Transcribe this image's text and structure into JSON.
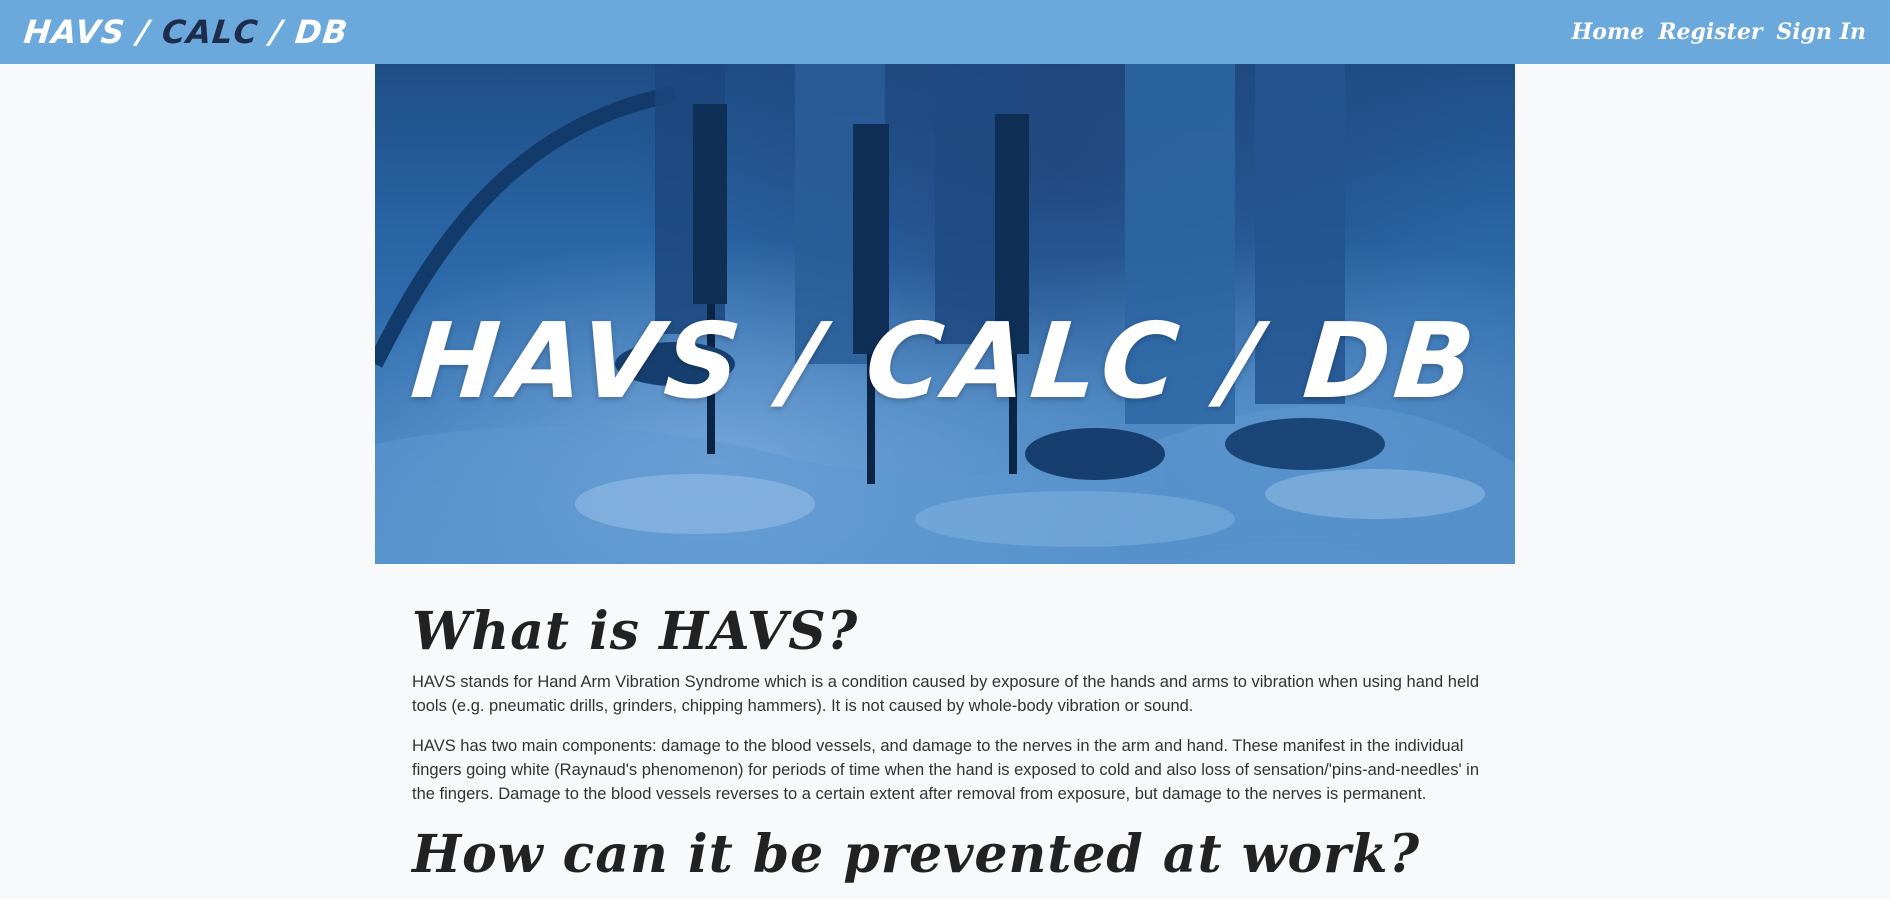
{
  "navbar": {
    "brand": {
      "part1": "HAVS / ",
      "part2": "CALC",
      "part3": " / DB"
    },
    "links": [
      "Home",
      "Register",
      "Sign In"
    ]
  },
  "hero": {
    "title": "HAVS / CALC / DB",
    "image_description": "workers with jackhammers, blue tint"
  },
  "sections": [
    {
      "heading": "What is HAVS?",
      "paragraphs": [
        "HAVS stands for Hand Arm Vibration Syndrome which is a condition caused by exposure of the hands and arms to vibration when using hand held tools (e.g. pneumatic drills, grinders, chipping hammers). It is not caused by whole-body vibration or sound.",
        "HAVS has two main components: damage to the blood vessels, and damage to the nerves in the arm and hand. These manifest in the individual fingers going white (Raynaud's phenomenon) for periods of time when the hand is exposed to cold and also loss of sensation/'pins-and-needles' in the fingers. Damage to the blood vessels reverses to a certain extent after removal from exposure, but damage to the nerves is permanent."
      ]
    },
    {
      "heading": "How can it be prevented at work?"
    }
  ],
  "colors": {
    "navbar": "#6ba8dc",
    "brand_accent": "#1f2d4d",
    "page_bg": "#f8f9fa"
  }
}
